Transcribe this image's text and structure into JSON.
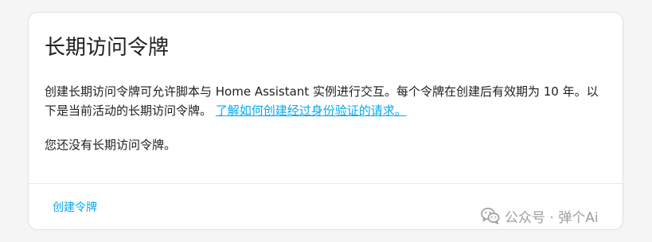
{
  "card": {
    "title": "长期访问令牌",
    "description": "创建长期访问令牌可允许脚本与 Home Assistant 实例进行交互。每个令牌在创建后有效期为 10 年。以下是当前活动的长期访问令牌。",
    "learn_link_text": "了解如何创建经过身份验证的请求。",
    "empty_text": "您还没有长期访问令牌。"
  },
  "actions": {
    "create_button_label": "创建令牌"
  },
  "watermark": {
    "text": "公众号 · 弹个Ai",
    "icon": "wechat-icon"
  },
  "colors": {
    "accent": "#03a9f4",
    "text": "#212121",
    "watermark": "#9e9e9e"
  }
}
